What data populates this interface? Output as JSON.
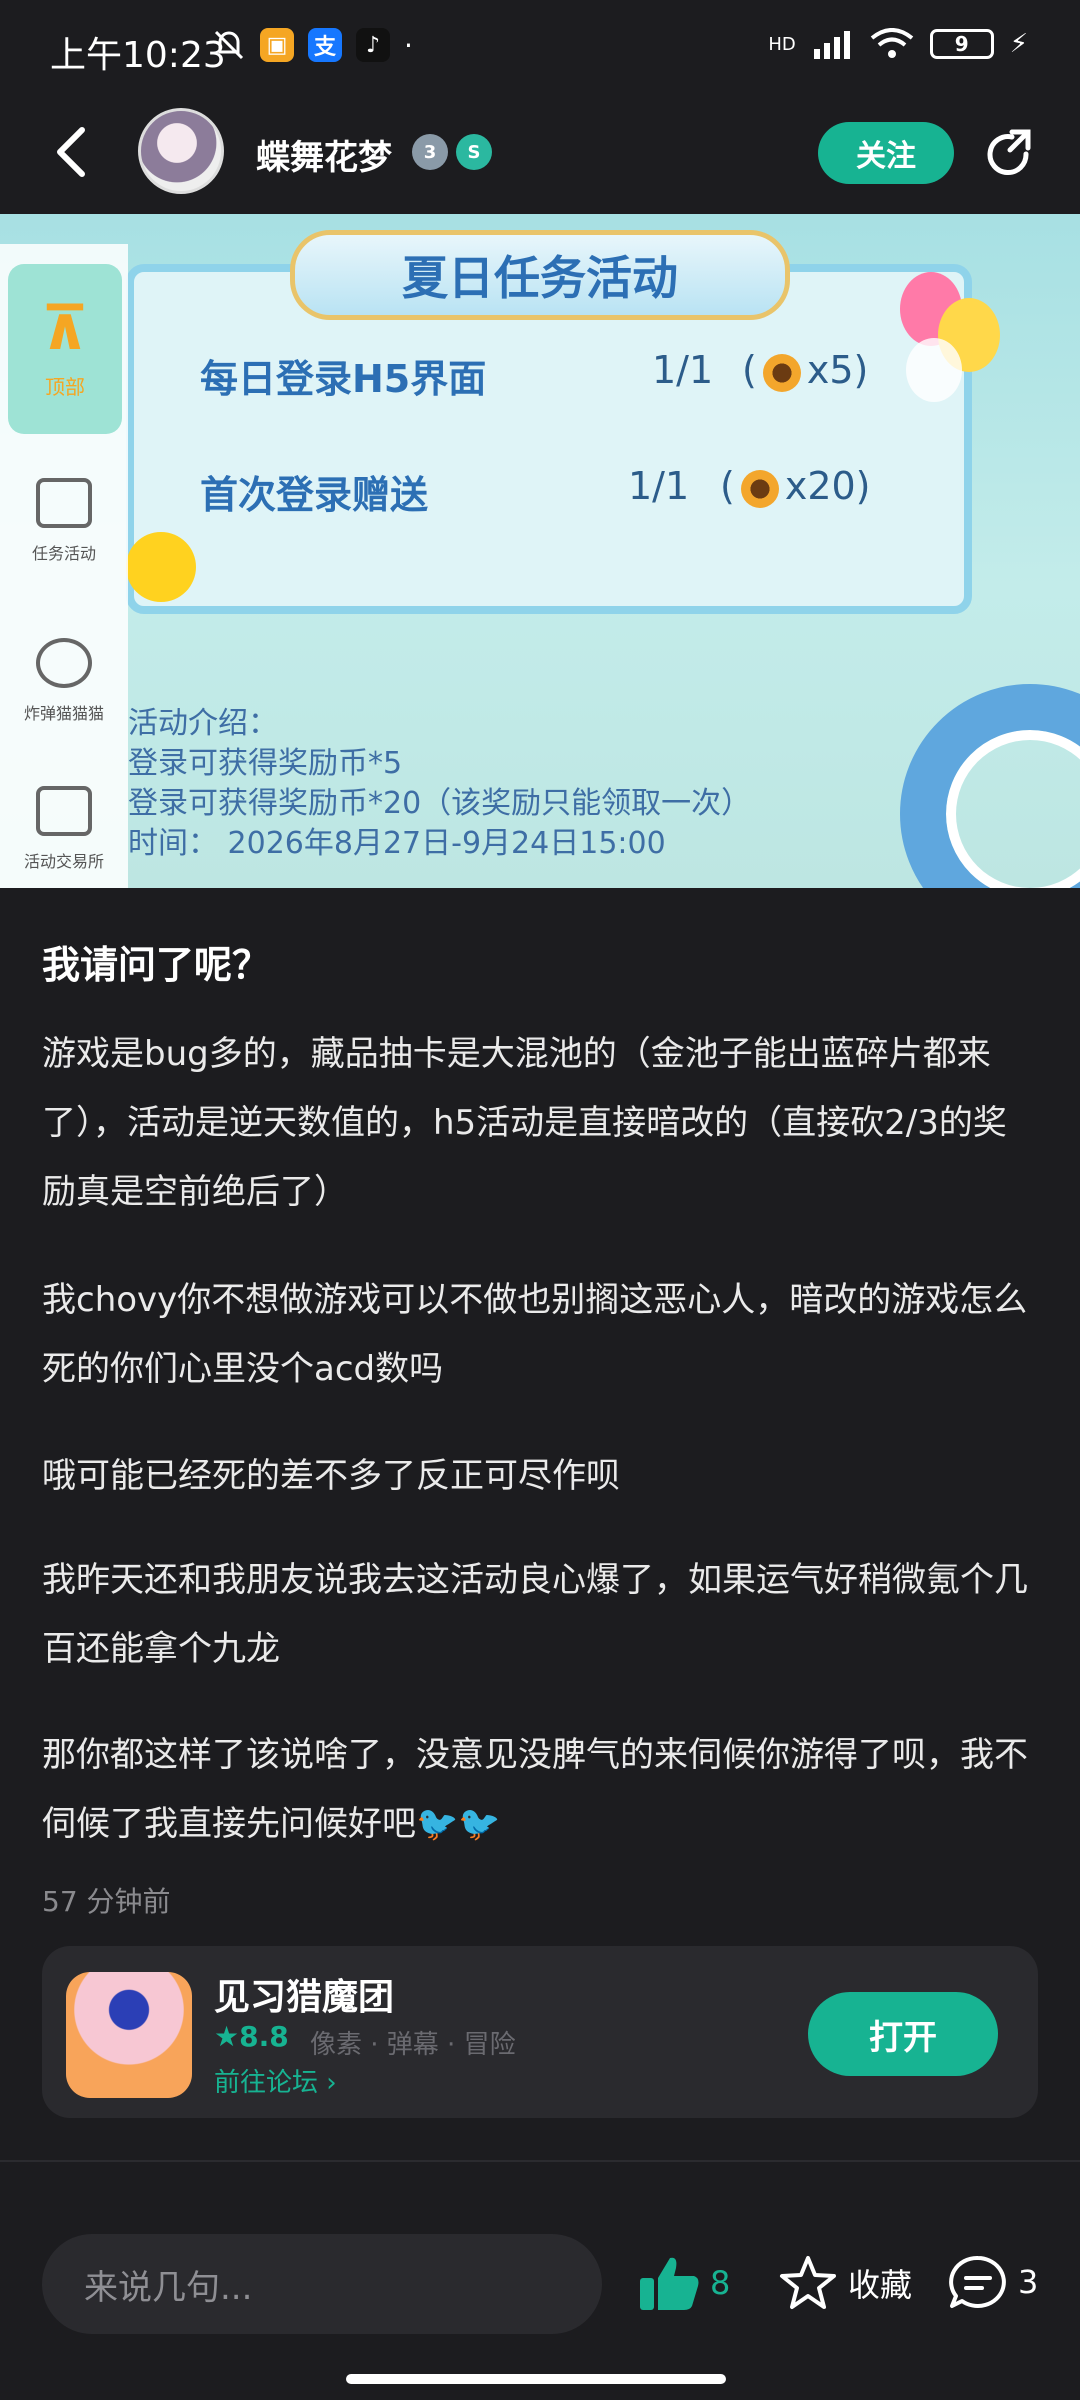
{
  "status": {
    "time": "上午10:23",
    "battery": "9",
    "signal": "HD"
  },
  "header": {
    "username": "蝶舞花梦",
    "badge_level": "3",
    "follow_label": "关注"
  },
  "banner": {
    "title": "夏日任务活动",
    "tasks": [
      {
        "name": "每日登录H5界面",
        "progress": "1/1",
        "reward_open": "(",
        "reward": "x5)"
      },
      {
        "name": "首次登录赠送",
        "progress": "1/1",
        "reward_open": "(",
        "reward": "x20)"
      }
    ],
    "desc": [
      "活动介绍：",
      "登录可获得奖励币*5",
      "登录可获得奖励币*20（该奖励只能领取一次）",
      "时间：   2026年8月27日-9月24日15:00"
    ],
    "sidebar": {
      "top_label": "顶部",
      "items": [
        "任务活动",
        "炸弹猫猫猫",
        "活动交易所"
      ]
    }
  },
  "post": {
    "title": "我请问了呢？",
    "paragraphs": [
      "游戏是bug多的，藏品抽卡是大混池的（金池子能出蓝碎片都来了），活动是逆天数值的，h5活动是直接暗改的（直接砍2/3的奖励真是空前绝后了）",
      "我chovy你不想做游戏可以不做也别搁这恶心人，暗改的游戏怎么死的你们心里没个acd数吗",
      "哦可能已经死的差不多了反正可尽作呗",
      "我昨天还和我朋友说我去这活动良心爆了，如果运气好稍微氪个几百还能拿个九龙",
      "那你都这样了该说啥了，没意见没脾气的来伺候你游得了呗，我不伺候了我直接先问候好吧"
    ],
    "time_ago": "57 分钟前"
  },
  "game": {
    "name": "见习猎魔团",
    "rating": "8.8",
    "tags": "像素 · 弹幕 · 冒险",
    "forum_link": "前往论坛",
    "open_label": "打开"
  },
  "bottom": {
    "comment_placeholder": "来说几句...",
    "like_count": "8",
    "collect_label": "收藏",
    "comment_count": "3"
  },
  "colors": {
    "accent": "#17b392",
    "background": "#1c1c1f",
    "card": "#2a2a2e"
  },
  "icons": [
    "mute-bell-icon",
    "wifi-icon",
    "signal-icon",
    "battery-icon",
    "back-arrow-icon",
    "share-icon",
    "thumbs-up-icon",
    "star-icon",
    "comment-icon",
    "bird-emoji-icon"
  ]
}
